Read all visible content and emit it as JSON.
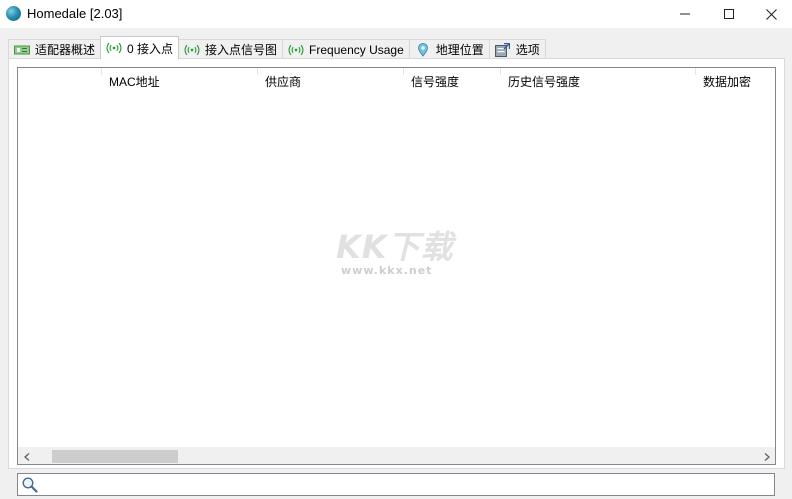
{
  "window": {
    "title": "Homedale [2.03]",
    "icon": "globe-icon"
  },
  "tabs": [
    {
      "label": "适配器概述",
      "icon": "adapter-icon",
      "active": false
    },
    {
      "label": "0 接入点",
      "icon": "wifi-signal-icon",
      "active": true
    },
    {
      "label": "接入点信号图",
      "icon": "wifi-signal-icon",
      "active": false
    },
    {
      "label": "Frequency Usage",
      "icon": "wifi-signal-icon",
      "active": false
    },
    {
      "label": "地理位置",
      "icon": "location-pin-icon",
      "active": false
    },
    {
      "label": "选项",
      "icon": "options-icon",
      "active": false
    }
  ],
  "list": {
    "columns": [
      {
        "label": ""
      },
      {
        "label": "MAC地址"
      },
      {
        "label": "供应商"
      },
      {
        "label": "信号强度"
      },
      {
        "label": "历史信号强度"
      },
      {
        "label": "数据加密"
      }
    ],
    "rows": []
  },
  "watermark": {
    "logo": "KK下载",
    "url": "www.kkx.net"
  },
  "search": {
    "value": "",
    "placeholder": ""
  },
  "colors": {
    "accent_tab_icon": "#2e9e3e",
    "border": "#828790",
    "thumb": "#cdcdcd"
  }
}
